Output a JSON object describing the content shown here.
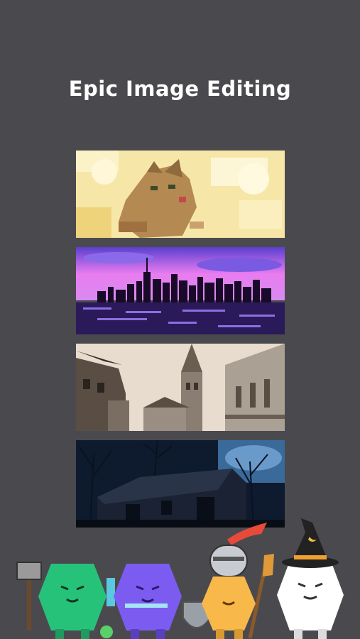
{
  "header": {
    "title": "Epic Image Editing"
  },
  "gallery": {
    "images": [
      {
        "name": "cat",
        "subject": "cat-photo",
        "effect": "pixelate"
      },
      {
        "name": "city",
        "subject": "city-skyline-photo",
        "effect": "color-shift"
      },
      {
        "name": "church",
        "subject": "church-street-photo",
        "effect": "sepia"
      },
      {
        "name": "barn",
        "subject": "barn-at-night-photo",
        "effect": "dark-blue"
      }
    ]
  },
  "characters": [
    {
      "name": "warrior",
      "color": "#27c27a",
      "icon": "hammer-icon"
    },
    {
      "name": "mage-purple",
      "color": "#7c5cf0",
      "icon": "sword-icon"
    },
    {
      "name": "knight",
      "color": "#f8b94a",
      "icon": "knight-helmet-icon"
    },
    {
      "name": "wizard",
      "color": "#ffffff",
      "icon": "wizard-hat-icon"
    }
  ],
  "colors": {
    "background": "#4a4a4e",
    "title": "#ffffff"
  }
}
